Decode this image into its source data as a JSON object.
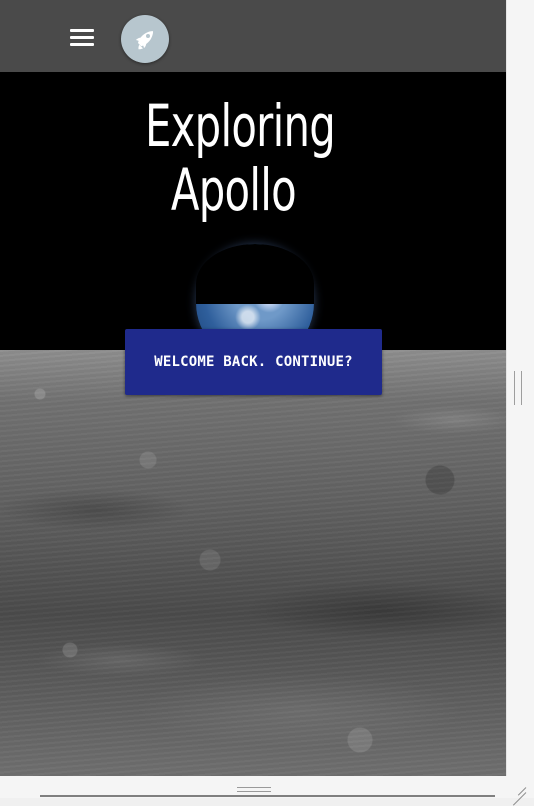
{
  "header": {
    "menu_icon": "menu-icon",
    "logo_icon": "rocket-icon"
  },
  "hero": {
    "title_line_1": "Exploring",
    "title_line_2": "Apollo",
    "button_label": "WELCOME BACK. CONTINUE?"
  },
  "colors": {
    "topbar": "#4a4a4a",
    "logo_circle": "#b7c6ce",
    "button": "#1f2a8c"
  }
}
